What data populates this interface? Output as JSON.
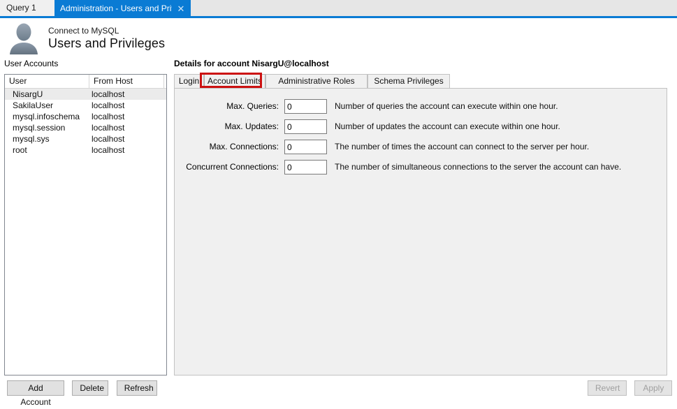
{
  "window_tabs": {
    "items": [
      {
        "label": "Query 1",
        "active": false
      },
      {
        "label": "Administration - Users and Privil...",
        "active": true
      }
    ],
    "close_glyph": "✕"
  },
  "header": {
    "subtitle": "Connect to MySQL",
    "title": "Users and Privileges",
    "avatar_icon": "user-silhouette-icon"
  },
  "left": {
    "section_label": "User Accounts",
    "columns": [
      "User",
      "From Host"
    ],
    "rows": [
      {
        "user": "NisargU",
        "host": "localhost",
        "selected": true
      },
      {
        "user": "SakilaUser",
        "host": "localhost",
        "selected": false
      },
      {
        "user": "mysql.infoschema",
        "host": "localhost",
        "selected": false
      },
      {
        "user": "mysql.session",
        "host": "localhost",
        "selected": false
      },
      {
        "user": "mysql.sys",
        "host": "localhost",
        "selected": false
      },
      {
        "user": "root",
        "host": "localhost",
        "selected": false
      }
    ],
    "buttons": {
      "add_account": "Add Account",
      "delete": "Delete",
      "refresh": "Refresh"
    }
  },
  "details": {
    "title": "Details for account NisargU@localhost",
    "tabs": [
      {
        "label": "Login",
        "active": false
      },
      {
        "label": "Account Limits",
        "active": true
      },
      {
        "label": "Administrative Roles",
        "active": false
      },
      {
        "label": "Schema Privileges",
        "active": false
      }
    ],
    "fields": [
      {
        "label": "Max. Queries:",
        "value": "0",
        "hint": "Number of queries the account can execute within one hour."
      },
      {
        "label": "Max. Updates:",
        "value": "0",
        "hint": "Number of updates the account can execute within one hour."
      },
      {
        "label": "Max. Connections:",
        "value": "0",
        "hint": "The number of times the account can connect to the server per hour."
      },
      {
        "label": "Concurrent Connections:",
        "value": "0",
        "hint": "The number of simultaneous connections to the server the account can have."
      }
    ],
    "buttons": {
      "revert": "Revert",
      "apply": "Apply"
    }
  },
  "annotation": {
    "target": "Account Limits",
    "color": "#cc1111"
  },
  "colors": {
    "active_tab_blue": "#0a7bd4",
    "panel_gray": "#f0f0f0",
    "annotation_red": "#cc1111"
  }
}
